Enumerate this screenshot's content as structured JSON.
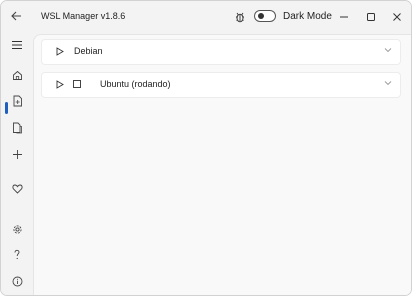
{
  "title_bar": {
    "app_title": "WSL Manager v1.8.6",
    "dark_mode_label": "Dark Mode",
    "dark_mode_on": false
  },
  "sidebar": {
    "items": [
      {
        "icon": "menu-icon"
      },
      {
        "icon": "home-icon",
        "active": true
      },
      {
        "icon": "file-add-icon"
      },
      {
        "icon": "file-copy-icon"
      },
      {
        "icon": "plus-icon"
      },
      {
        "icon": "heart-icon"
      },
      {
        "icon": "gear-icon"
      },
      {
        "icon": "help-icon"
      },
      {
        "icon": "info-icon"
      }
    ]
  },
  "distros": [
    {
      "name": "Debian",
      "running": false
    },
    {
      "name": "Ubuntu (rodando)",
      "running": true
    }
  ],
  "colors": {
    "accent": "#1f5fbf",
    "window_bg": "#f3f3f3",
    "content_bg": "#f9f9f9",
    "card_bg": "#ffffff"
  }
}
